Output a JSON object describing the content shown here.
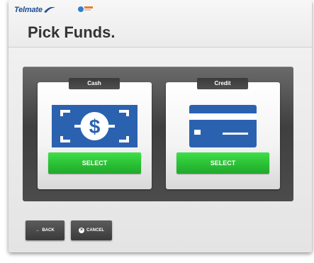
{
  "brand": {
    "name": "Telmate"
  },
  "page": {
    "title": "Pick Funds."
  },
  "options": [
    {
      "label": "Cash",
      "button": "SELECT",
      "icon": "cash-bill-icon"
    },
    {
      "label": "Credit",
      "button": "SELECT",
      "icon": "credit-card-icon"
    }
  ],
  "footer": {
    "back_label": "BACK",
    "cancel_label": "CANCEL"
  },
  "colors": {
    "brand_blue": "#1d4f91",
    "select_green": "#2cc236",
    "panel_dark": "#4c4c4c"
  }
}
